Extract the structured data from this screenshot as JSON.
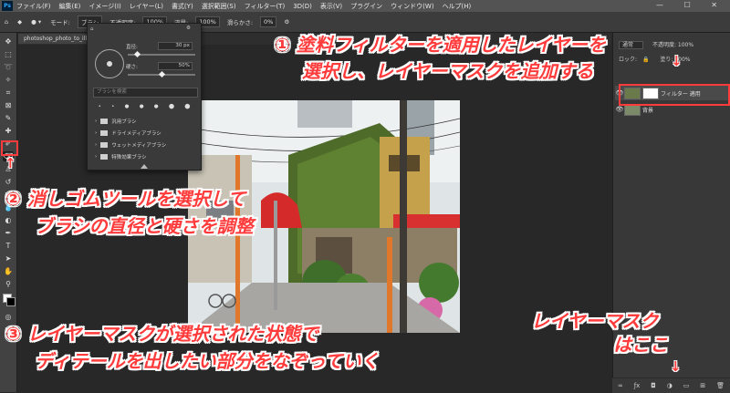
{
  "menubar": {
    "app_badge": "Ps",
    "items": [
      "ファイル(F)",
      "編集(E)",
      "イメージ(I)",
      "レイヤー(L)",
      "書式(Y)",
      "選択範囲(S)",
      "フィルター(T)",
      "3D(D)",
      "表示(V)",
      "プラグイン",
      "ウィンドウ(W)",
      "ヘルプ(H)"
    ],
    "window_controls": "— ☐ ✕"
  },
  "options": {
    "mode_label": "モード:",
    "mode_value": "ブラシ",
    "opacity_label": "不透明度:",
    "opacity_value": "100%",
    "flow_label": "流量:",
    "flow_value": "100%",
    "smooth_label": "滑らかさ:",
    "smooth_value": "0%"
  },
  "document": {
    "tab_title": "photoshop_photo_to_illustration_2..."
  },
  "brush_popup": {
    "diameter_label": "直径:",
    "diameter_value": "30 px",
    "hardness_label": "硬さ:",
    "hardness_value": "50%",
    "search_placeholder": "ブラシを検索",
    "folders": [
      "汎用ブラシ",
      "ドライメディアブラシ",
      "ウェットメディアブラシ",
      "特殊効果ブラシ"
    ]
  },
  "layers": {
    "blend_mode": "通常",
    "opacity_label": "不透明度:",
    "opacity_value": "100%",
    "lock_label": "ロック:",
    "fill_label": "塗り:",
    "fill_value": "100%",
    "items": [
      {
        "name": "フィルター 適用"
      },
      {
        "name": "背景"
      }
    ]
  },
  "annotations": {
    "step1_num": "①",
    "step1_line1": "塗料フィルターを適用したレイヤーを",
    "step1_line2": "選択し、レイヤーマスクを追加する",
    "step2_num": "②",
    "step2_line1": "消しゴムツールを選択して",
    "step2_line2": "ブラシの直径と硬さを調整",
    "step3_num": "③",
    "step3_line1": "レイヤーマスクが選択された状態で",
    "step3_line2": "ディテールを出したい部分をなぞっていく",
    "mask_line1": "レイヤーマスク",
    "mask_line2": "はここ",
    "arrow_up": "↑",
    "arrow_down": "↓"
  },
  "colors": {
    "annotation_red": "#ff3b3b",
    "annotation_outline": "#ffffff",
    "ui_dark": "#282828",
    "panel": "#383838"
  }
}
